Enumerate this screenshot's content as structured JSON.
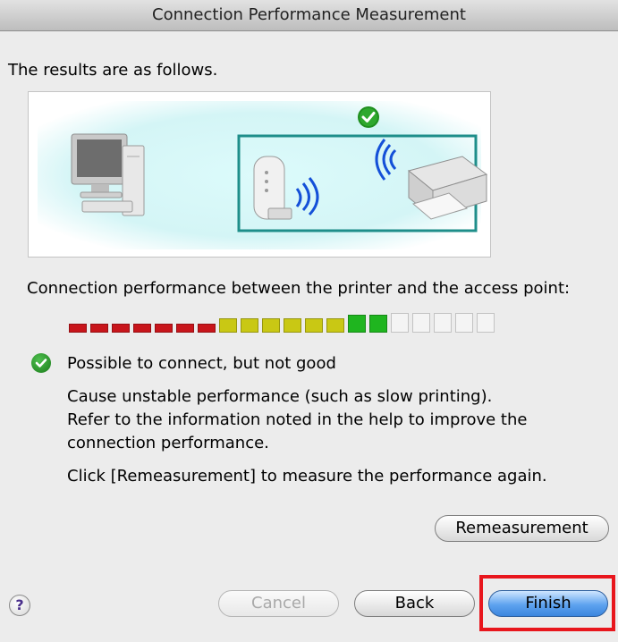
{
  "window": {
    "title": "Connection Performance Measurement"
  },
  "intro_text": "The results are as follows.",
  "performance_label": "Connection performance between the printer and the access point:",
  "signal_meter": {
    "total_segments": 20,
    "filled_segments": 15,
    "colors": {
      "red": "#c8151b",
      "yellow": "#c9c814",
      "green": "#1fb51f",
      "empty": "#f4f4f4"
    }
  },
  "status": {
    "title": "Possible to connect, but not good",
    "detail_line1": "Cause unstable performance (such as slow printing).",
    "detail_line2": "Refer to the information noted in the help to improve the",
    "detail_line3": "connection performance.",
    "remeasure_hint": "Click [Remeasurement] to measure the performance again."
  },
  "buttons": {
    "remeasurement": "Remeasurement",
    "cancel": "Cancel",
    "back": "Back",
    "finish": "Finish",
    "help": "?"
  },
  "colors": {
    "accent": "#e8161d",
    "highlight_box": "#1e8e8a",
    "illustration_bg": "#d9f7f7"
  }
}
